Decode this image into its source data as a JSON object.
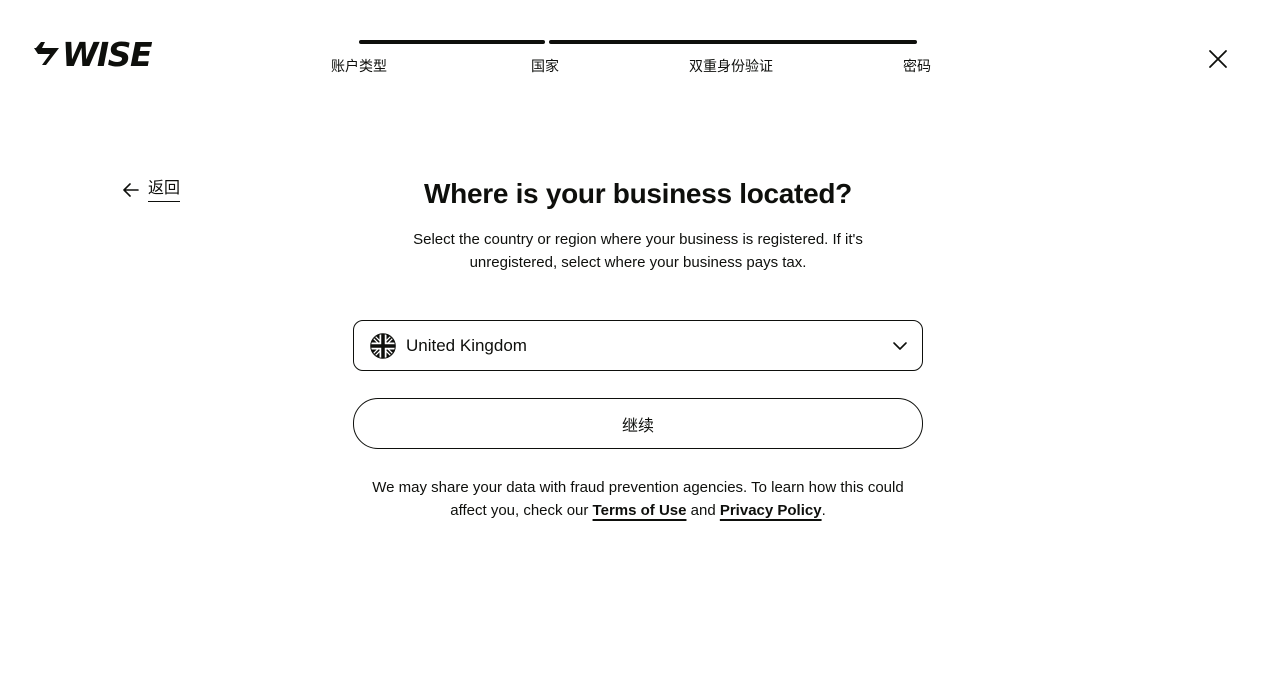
{
  "header": {
    "logo_text": "WISE",
    "close_icon": "close-icon"
  },
  "stepper": {
    "steps": [
      {
        "label": "账户类型",
        "status": "complete"
      },
      {
        "label": "国家",
        "status": "current"
      },
      {
        "label": "双重身份验证",
        "status": "upcoming"
      },
      {
        "label": "密码",
        "status": "upcoming"
      }
    ]
  },
  "back": {
    "label": "返回",
    "icon": "arrow-left-icon"
  },
  "main": {
    "title": "Where is your business located?",
    "subtitle": "Select the country or region where your business is registered. If it's unregistered, select where your business pays tax.",
    "country_select": {
      "value": "United Kingdom",
      "flag_icon": "uk-flag-icon",
      "chevron_icon": "chevron-down-icon"
    },
    "continue_label": "继续",
    "legal": {
      "text_before": "We may share your data with fraud prevention agencies. To learn how this could affect you, check our ",
      "terms_label": "Terms of Use",
      "and_text": " and ",
      "privacy_label": "Privacy Policy",
      "text_after": "."
    }
  },
  "colors": {
    "text": "#0e0f0c",
    "background": "#ffffff"
  }
}
